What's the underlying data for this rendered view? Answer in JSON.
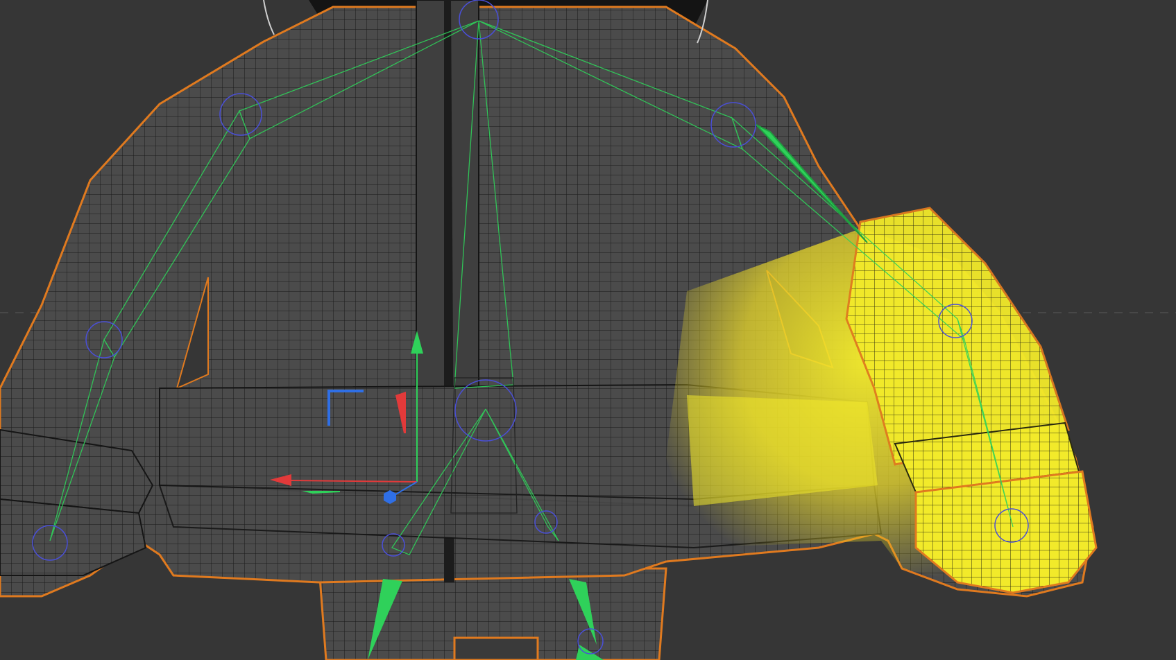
{
  "viewport": {
    "background": "#363636",
    "mesh_color": "#4a4a4a",
    "wire_color": "#161616",
    "outline_color": "#e07a1f",
    "bone_color": "#2fd15a",
    "joint_color": "#4a4fd8",
    "weight_color": "#f2ea2a",
    "gizmo": {
      "x_color": "#e23a3a",
      "y_color": "#2fd15a",
      "z_color": "#2f6fe6"
    }
  }
}
